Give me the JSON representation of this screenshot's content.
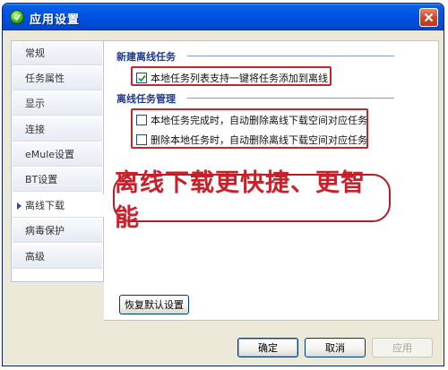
{
  "window": {
    "title": "应用设置"
  },
  "sidebar": {
    "items": [
      {
        "label": "常规"
      },
      {
        "label": "任务属性"
      },
      {
        "label": "显示"
      },
      {
        "label": "连接"
      },
      {
        "label": "eMule设置"
      },
      {
        "label": "BT设置"
      },
      {
        "label": "离线下载",
        "active": true
      },
      {
        "label": "病毒保护"
      },
      {
        "label": "高级"
      }
    ]
  },
  "sections": {
    "new_offline": {
      "title": "新建离线任务",
      "option": {
        "label": "本地任务列表支持一键将任务添加到离线",
        "checked": true
      }
    },
    "offline_manage": {
      "title": "离线任务管理",
      "options": [
        {
          "label": "本地任务完成时，自动删除离线下载空间对应任务",
          "checked": false
        },
        {
          "label": "删除本地任务时，自动删除离线下载空间对应任务",
          "checked": false
        }
      ]
    }
  },
  "promo": {
    "text": "离线下载更快捷、更智能"
  },
  "buttons": {
    "restore_defaults": "恢复默认设置",
    "ok": "确定",
    "cancel": "取消",
    "apply": "应用"
  },
  "colors": {
    "titlebar": "#0055e5",
    "highlight": "#c0282d",
    "promo_text": "#c9202a",
    "section_title": "#1f3b8a"
  }
}
